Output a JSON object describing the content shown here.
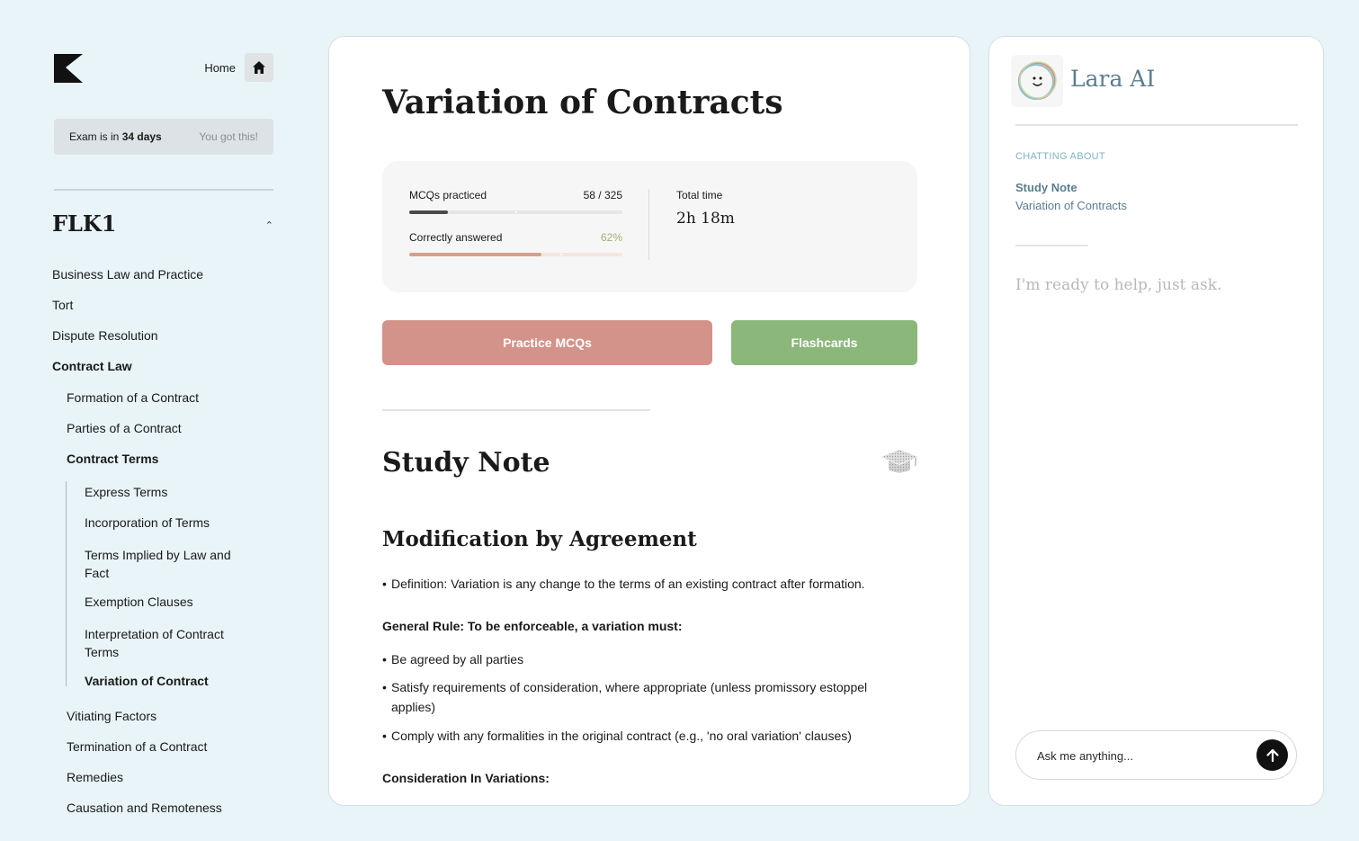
{
  "sidebar": {
    "home_label": "Home",
    "exam": {
      "prefix": "Exam is in ",
      "days": "34 days",
      "encourage": "You got this!"
    },
    "course_title": "FLK1",
    "items": [
      {
        "label": "Business Law and Practice"
      },
      {
        "label": "Tort"
      },
      {
        "label": "Dispute Resolution"
      },
      {
        "label": "Contract Law"
      },
      {
        "label": "Formation of a Contract"
      },
      {
        "label": "Parties of a Contract"
      },
      {
        "label": "Contract Terms"
      },
      {
        "label": "Express Terms"
      },
      {
        "label": "Incorporation of Terms"
      },
      {
        "label": "Terms Implied by Law and Fact"
      },
      {
        "label": "Exemption Clauses"
      },
      {
        "label": "Interpretation of Contract Terms"
      },
      {
        "label": "Variation of Contract"
      },
      {
        "label": "Vitiating Factors"
      },
      {
        "label": "Termination of a Contract"
      },
      {
        "label": "Remedies"
      },
      {
        "label": "Causation and Remoteness"
      }
    ]
  },
  "main": {
    "title": "Variation of Contracts",
    "stats": {
      "mcq_label": "MCQs practiced",
      "mcq_value": "58 / 325",
      "mcq_progress": 0.18,
      "correct_label": "Correctly answered",
      "correct_value": "62%",
      "correct_progress": 0.62,
      "time_label": "Total time",
      "time_value": "2h 18m"
    },
    "buttons": {
      "practice": "Practice MCQs",
      "flashcards": "Flashcards"
    },
    "study_title": "Study Note",
    "section_title": "Modification by Agreement",
    "definition": "Definition: Variation is any change to the terms of an existing contract after formation.",
    "rule_heading": "General Rule: To be enforceable, a variation must:",
    "rules": [
      "Be agreed by all parties",
      "Satisfy requirements of consideration, where appropriate (unless promissory estoppel applies)",
      "Comply with any formalities in the original contract (e.g., 'no oral variation' clauses)"
    ],
    "consideration_heading": "Consideration In Variations:"
  },
  "chat": {
    "name": "Lara AI",
    "about_label": "CHATTING ABOUT",
    "about_kind": "Study Note",
    "about_topic": "Variation of Contracts",
    "ready": "I'm ready to help, just ask.",
    "placeholder": "Ask me anything..."
  },
  "colors": {
    "background": "#e8f4f8",
    "practice_button": "#d4938a",
    "flashcards_button": "#8bb77b",
    "chat_accent": "#5a7e8f"
  }
}
